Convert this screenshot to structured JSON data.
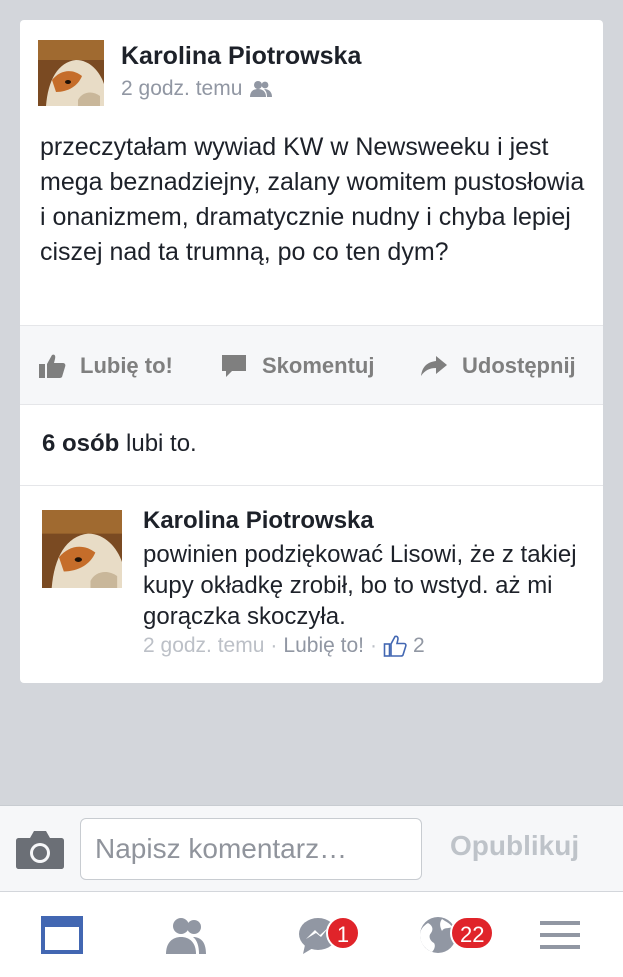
{
  "post": {
    "author": "Karolina Piotrowska",
    "time": "2 godz. temu",
    "audience_icon": "friends-audience-icon",
    "text": "przeczytałam wywiad KW w Newsweeku i jest mega beznadziejny, zalany womitem pustosłowia i onanizmem, dramatycznie nudny i chyba lepiej ciszej nad ta trumną, po co ten dym?"
  },
  "actions": {
    "like": "Lubię to!",
    "comment": "Skomentuj",
    "share": "Udostępnij"
  },
  "likes": {
    "count": "6 osób",
    "suffix": " lubi to."
  },
  "comment": {
    "author": "Karolina Piotrowska",
    "text": "powinien podziękować Lisowi, że z takiej kupy okładkę zrobił, bo to wstyd. aż mi gorączka skoczyła.",
    "time": "2 godz. temu",
    "separator": "·",
    "like_label": "Lubię to!",
    "like_count": "2"
  },
  "composer": {
    "placeholder": "Napisz komentarz…",
    "publish_label": "Opublikuj"
  },
  "tabbar": {
    "messages_badge": "1",
    "notifications_badge": "22"
  },
  "colors": {
    "accent": "#4267b2",
    "badge": "#e0242a",
    "background": "#d3d6db"
  }
}
